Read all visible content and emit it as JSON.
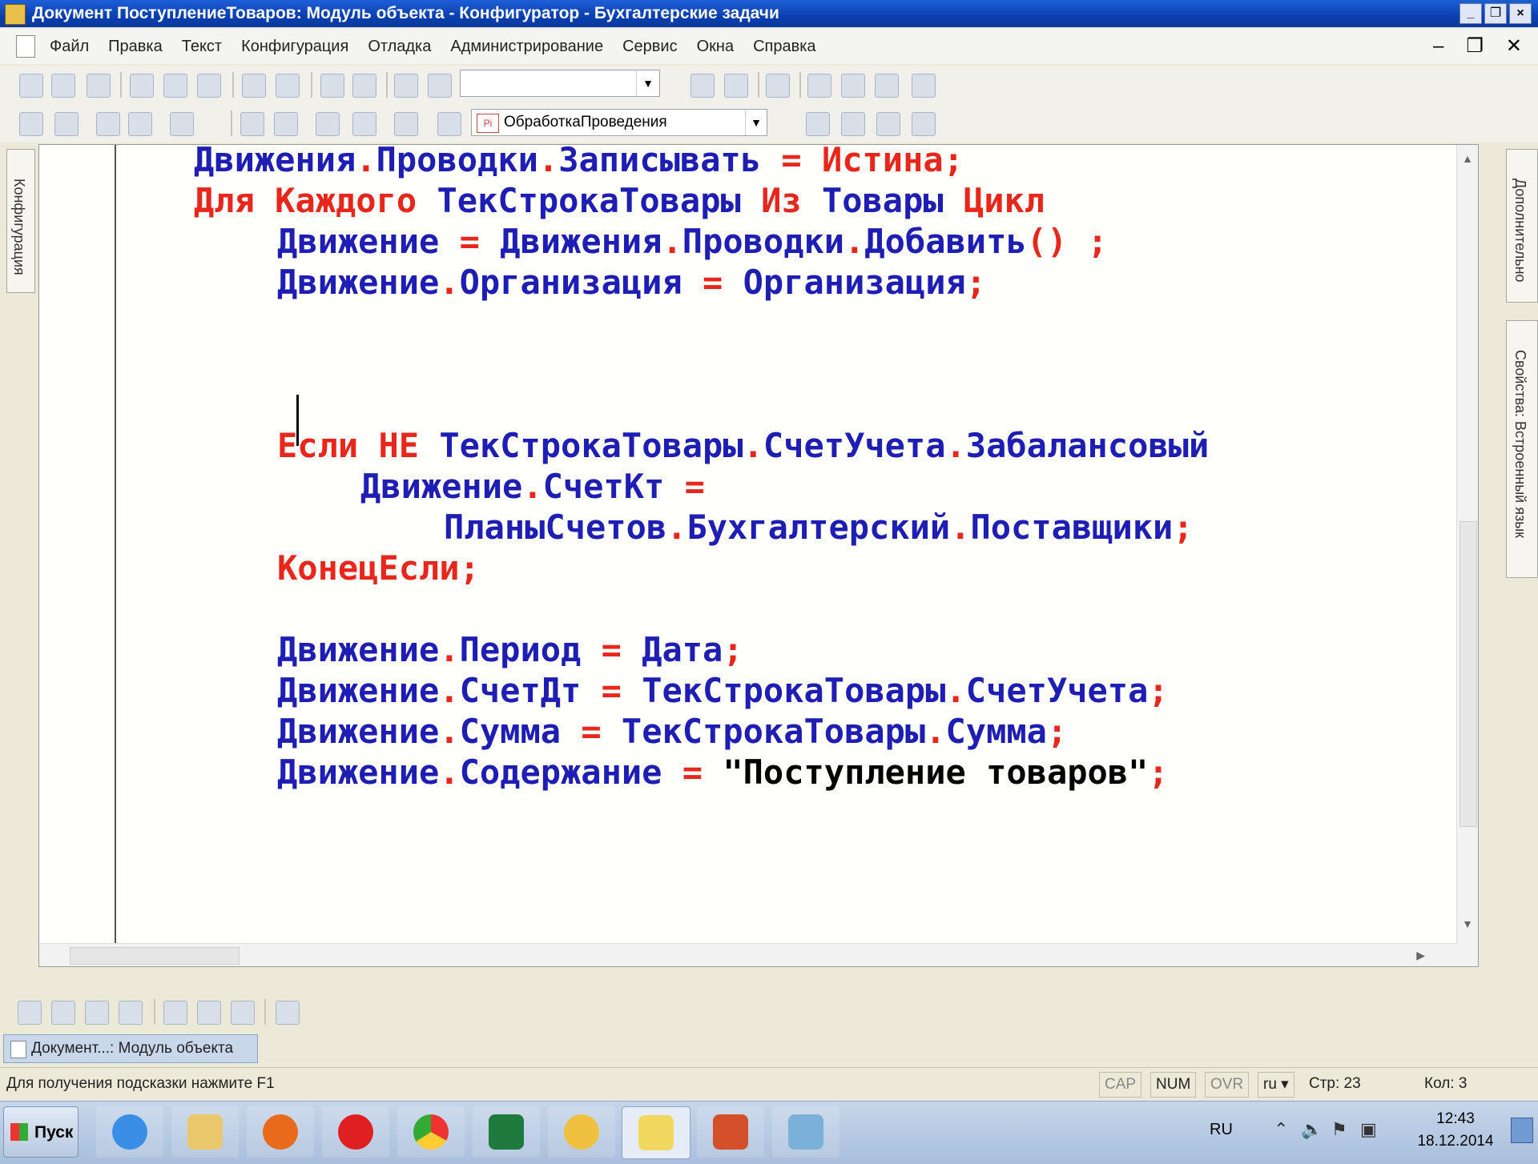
{
  "window": {
    "title": "Документ ПоступлениеТоваров: Модуль объекта - Конфигуратор - Бухгалтерские задачи",
    "controls": [
      "_",
      "❐",
      "×"
    ]
  },
  "menu": {
    "items": [
      "Файл",
      "Правка",
      "Текст",
      "Конфигурация",
      "Отладка",
      "Администрирование",
      "Сервис",
      "Окна",
      "Справка"
    ],
    "mdi_controls": [
      "–",
      "❐",
      "✕"
    ]
  },
  "toolbar": {
    "search_value": "",
    "procedure_combo": "ОбработкаПроведения",
    "procedure_icon": "Pi"
  },
  "docks": {
    "left_tab": "Конфигурация",
    "right_tab_1": "Дополнительно",
    "right_tab_2": "Свойства: Встроенный язык"
  },
  "editor": {
    "lines": [
      {
        "tokens": [
          [
            "b",
            "Движения"
          ],
          [
            "r",
            "."
          ],
          [
            "b",
            "Проводки"
          ],
          [
            "r",
            "."
          ],
          [
            "b",
            "Записывать"
          ],
          [
            "k",
            " "
          ],
          [
            "r",
            "="
          ],
          [
            "k",
            " "
          ],
          [
            "r",
            "Истина"
          ],
          [
            "r",
            ";"
          ]
        ]
      },
      {
        "tokens": [
          [
            "r",
            "Для"
          ],
          [
            "k",
            " "
          ],
          [
            "r",
            "Каждого"
          ],
          [
            "k",
            " "
          ],
          [
            "b",
            "ТекСтрокаТовары"
          ],
          [
            "k",
            " "
          ],
          [
            "r",
            "Из"
          ],
          [
            "k",
            " "
          ],
          [
            "b",
            "Товары"
          ],
          [
            "k",
            " "
          ],
          [
            "r",
            "Цикл"
          ]
        ]
      },
      {
        "tokens": [
          [
            "b",
            "Движение"
          ],
          [
            "k",
            " "
          ],
          [
            "r",
            "="
          ],
          [
            "k",
            " "
          ],
          [
            "b",
            "Движения"
          ],
          [
            "r",
            "."
          ],
          [
            "b",
            "Проводки"
          ],
          [
            "r",
            "."
          ],
          [
            "b",
            "Добавить"
          ],
          [
            "r",
            "()"
          ],
          [
            "k",
            " "
          ],
          [
            "r",
            ";"
          ]
        ]
      },
      {
        "tokens": [
          [
            "b",
            "Движение"
          ],
          [
            "r",
            "."
          ],
          [
            "b",
            "Организация"
          ],
          [
            "k",
            " "
          ],
          [
            "r",
            "="
          ],
          [
            "k",
            " "
          ],
          [
            "b",
            "Организация"
          ],
          [
            "r",
            ";"
          ]
        ]
      },
      {
        "tokens": [
          [
            "r",
            "Если"
          ],
          [
            "k",
            " "
          ],
          [
            "r",
            "НЕ"
          ],
          [
            "k",
            " "
          ],
          [
            "b",
            "ТекСтрокаТовары"
          ],
          [
            "r",
            "."
          ],
          [
            "b",
            "СчетУчета"
          ],
          [
            "r",
            "."
          ],
          [
            "b",
            "Забалансовый"
          ]
        ]
      },
      {
        "tokens": [
          [
            "b",
            "Движение"
          ],
          [
            "r",
            "."
          ],
          [
            "b",
            "СчетКт"
          ],
          [
            "k",
            " "
          ],
          [
            "r",
            "="
          ]
        ]
      },
      {
        "tokens": [
          [
            "b",
            "ПланыСчетов"
          ],
          [
            "r",
            "."
          ],
          [
            "b",
            "Бухгалтерский"
          ],
          [
            "r",
            "."
          ],
          [
            "b",
            "Поставщики"
          ],
          [
            "r",
            ";"
          ]
        ]
      },
      {
        "tokens": [
          [
            "r",
            "КонецЕсли"
          ],
          [
            "r",
            ";"
          ]
        ]
      },
      {
        "tokens": [
          [
            "b",
            "Движение"
          ],
          [
            "r",
            "."
          ],
          [
            "b",
            "Период"
          ],
          [
            "k",
            " "
          ],
          [
            "r",
            "="
          ],
          [
            "k",
            " "
          ],
          [
            "b",
            "Дата"
          ],
          [
            "r",
            ";"
          ]
        ]
      },
      {
        "tokens": [
          [
            "b",
            "Движение"
          ],
          [
            "r",
            "."
          ],
          [
            "b",
            "СчетДт"
          ],
          [
            "k",
            " "
          ],
          [
            "r",
            "="
          ],
          [
            "k",
            " "
          ],
          [
            "b",
            "ТекСтрокаТовары"
          ],
          [
            "r",
            "."
          ],
          [
            "b",
            "СчетУчета"
          ],
          [
            "r",
            ";"
          ]
        ]
      },
      {
        "tokens": [
          [
            "b",
            "Движение"
          ],
          [
            "r",
            "."
          ],
          [
            "b",
            "Сумма"
          ],
          [
            "k",
            " "
          ],
          [
            "r",
            "="
          ],
          [
            "k",
            " "
          ],
          [
            "b",
            "ТекСтрокаТовары"
          ],
          [
            "r",
            "."
          ],
          [
            "b",
            "Сумма"
          ],
          [
            "r",
            ";"
          ]
        ]
      },
      {
        "tokens": [
          [
            "b",
            "Движение"
          ],
          [
            "r",
            "."
          ],
          [
            "b",
            "Содержание"
          ],
          [
            "k",
            " "
          ],
          [
            "r",
            "="
          ],
          [
            "k",
            " "
          ],
          [
            "k",
            "\"Поступление товаров\""
          ],
          [
            "r",
            ";"
          ]
        ]
      }
    ]
  },
  "window_tab": {
    "label": "Документ...: Модуль объекта"
  },
  "status": {
    "hint": "Для получения подсказки нажмите F1",
    "cap": "CAP",
    "num": "NUM",
    "ovr": "OVR",
    "lang": "ru ▾",
    "line": "Стр: 23",
    "col": "Кол: 3"
  },
  "taskbar": {
    "start": "Пуск",
    "lang": "RU",
    "time": "12:43",
    "date": "18.12.2014"
  },
  "colors": {
    "keyword": "#e8261c",
    "identifier": "#1e1eb4",
    "string": "#000000"
  }
}
